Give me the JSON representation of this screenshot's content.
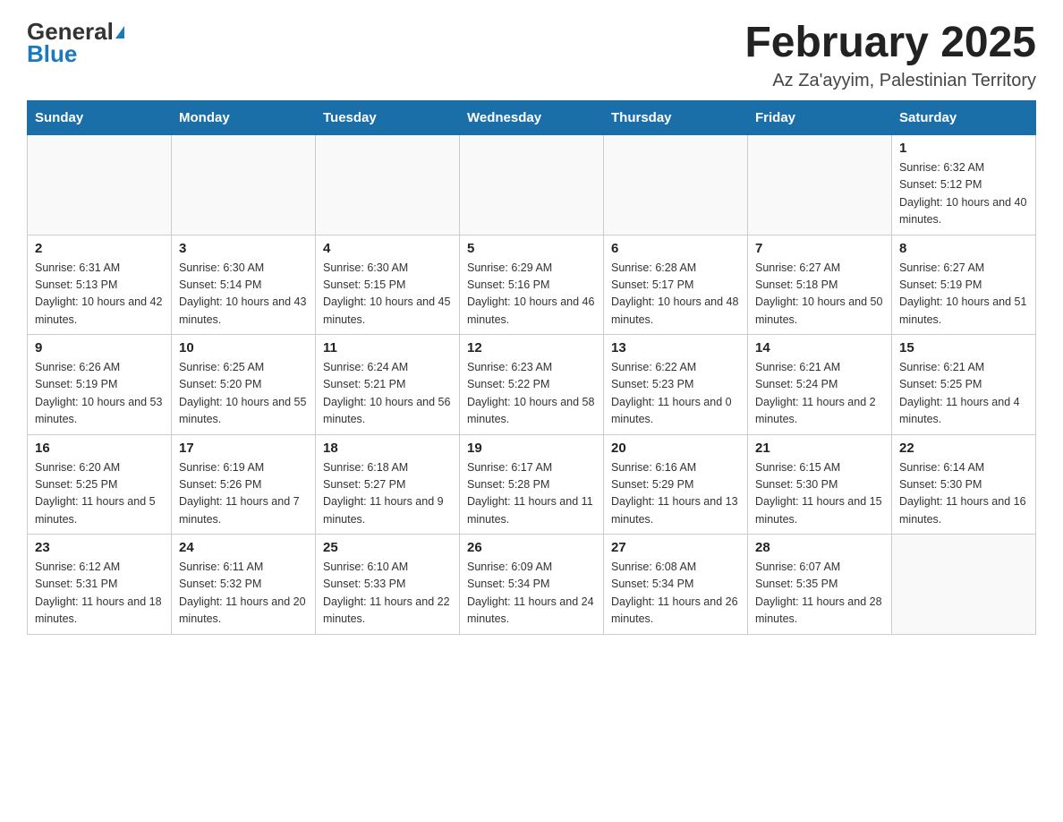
{
  "header": {
    "logo_general": "General",
    "logo_blue": "Blue",
    "title": "February 2025",
    "subtitle": "Az Za'ayyim, Palestinian Territory"
  },
  "weekdays": [
    "Sunday",
    "Monday",
    "Tuesday",
    "Wednesday",
    "Thursday",
    "Friday",
    "Saturday"
  ],
  "weeks": [
    [
      {
        "day": "",
        "info": ""
      },
      {
        "day": "",
        "info": ""
      },
      {
        "day": "",
        "info": ""
      },
      {
        "day": "",
        "info": ""
      },
      {
        "day": "",
        "info": ""
      },
      {
        "day": "",
        "info": ""
      },
      {
        "day": "1",
        "info": "Sunrise: 6:32 AM\nSunset: 5:12 PM\nDaylight: 10 hours and 40 minutes."
      }
    ],
    [
      {
        "day": "2",
        "info": "Sunrise: 6:31 AM\nSunset: 5:13 PM\nDaylight: 10 hours and 42 minutes."
      },
      {
        "day": "3",
        "info": "Sunrise: 6:30 AM\nSunset: 5:14 PM\nDaylight: 10 hours and 43 minutes."
      },
      {
        "day": "4",
        "info": "Sunrise: 6:30 AM\nSunset: 5:15 PM\nDaylight: 10 hours and 45 minutes."
      },
      {
        "day": "5",
        "info": "Sunrise: 6:29 AM\nSunset: 5:16 PM\nDaylight: 10 hours and 46 minutes."
      },
      {
        "day": "6",
        "info": "Sunrise: 6:28 AM\nSunset: 5:17 PM\nDaylight: 10 hours and 48 minutes."
      },
      {
        "day": "7",
        "info": "Sunrise: 6:27 AM\nSunset: 5:18 PM\nDaylight: 10 hours and 50 minutes."
      },
      {
        "day": "8",
        "info": "Sunrise: 6:27 AM\nSunset: 5:19 PM\nDaylight: 10 hours and 51 minutes."
      }
    ],
    [
      {
        "day": "9",
        "info": "Sunrise: 6:26 AM\nSunset: 5:19 PM\nDaylight: 10 hours and 53 minutes."
      },
      {
        "day": "10",
        "info": "Sunrise: 6:25 AM\nSunset: 5:20 PM\nDaylight: 10 hours and 55 minutes."
      },
      {
        "day": "11",
        "info": "Sunrise: 6:24 AM\nSunset: 5:21 PM\nDaylight: 10 hours and 56 minutes."
      },
      {
        "day": "12",
        "info": "Sunrise: 6:23 AM\nSunset: 5:22 PM\nDaylight: 10 hours and 58 minutes."
      },
      {
        "day": "13",
        "info": "Sunrise: 6:22 AM\nSunset: 5:23 PM\nDaylight: 11 hours and 0 minutes."
      },
      {
        "day": "14",
        "info": "Sunrise: 6:21 AM\nSunset: 5:24 PM\nDaylight: 11 hours and 2 minutes."
      },
      {
        "day": "15",
        "info": "Sunrise: 6:21 AM\nSunset: 5:25 PM\nDaylight: 11 hours and 4 minutes."
      }
    ],
    [
      {
        "day": "16",
        "info": "Sunrise: 6:20 AM\nSunset: 5:25 PM\nDaylight: 11 hours and 5 minutes."
      },
      {
        "day": "17",
        "info": "Sunrise: 6:19 AM\nSunset: 5:26 PM\nDaylight: 11 hours and 7 minutes."
      },
      {
        "day": "18",
        "info": "Sunrise: 6:18 AM\nSunset: 5:27 PM\nDaylight: 11 hours and 9 minutes."
      },
      {
        "day": "19",
        "info": "Sunrise: 6:17 AM\nSunset: 5:28 PM\nDaylight: 11 hours and 11 minutes."
      },
      {
        "day": "20",
        "info": "Sunrise: 6:16 AM\nSunset: 5:29 PM\nDaylight: 11 hours and 13 minutes."
      },
      {
        "day": "21",
        "info": "Sunrise: 6:15 AM\nSunset: 5:30 PM\nDaylight: 11 hours and 15 minutes."
      },
      {
        "day": "22",
        "info": "Sunrise: 6:14 AM\nSunset: 5:30 PM\nDaylight: 11 hours and 16 minutes."
      }
    ],
    [
      {
        "day": "23",
        "info": "Sunrise: 6:12 AM\nSunset: 5:31 PM\nDaylight: 11 hours and 18 minutes."
      },
      {
        "day": "24",
        "info": "Sunrise: 6:11 AM\nSunset: 5:32 PM\nDaylight: 11 hours and 20 minutes."
      },
      {
        "day": "25",
        "info": "Sunrise: 6:10 AM\nSunset: 5:33 PM\nDaylight: 11 hours and 22 minutes."
      },
      {
        "day": "26",
        "info": "Sunrise: 6:09 AM\nSunset: 5:34 PM\nDaylight: 11 hours and 24 minutes."
      },
      {
        "day": "27",
        "info": "Sunrise: 6:08 AM\nSunset: 5:34 PM\nDaylight: 11 hours and 26 minutes."
      },
      {
        "day": "28",
        "info": "Sunrise: 6:07 AM\nSunset: 5:35 PM\nDaylight: 11 hours and 28 minutes."
      },
      {
        "day": "",
        "info": ""
      }
    ]
  ]
}
